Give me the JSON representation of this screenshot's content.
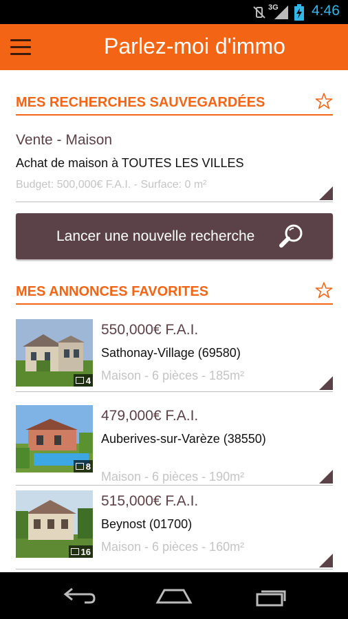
{
  "status_bar": {
    "network": "3G",
    "time": "4:46",
    "time_color": "#33b5e5"
  },
  "app_bar": {
    "title": "Parlez-moi d'immo",
    "color": "#f36515",
    "menu_icon": "hamburger-menu-icon"
  },
  "saved_searches": {
    "heading": "MES RECHERCHES SAUVEGARDÉES",
    "star_icon": "star-outline-icon",
    "items": [
      {
        "type": "Vente - Maison",
        "description": "Achat de maison à TOUTES LES VILLES",
        "meta": "Budget: 500,000€ F.A.I. - Surface: 0 m²"
      }
    ]
  },
  "new_search_button": {
    "label": "Lancer une nouvelle recherche",
    "icon": "search-magnifier-icon",
    "color": "#5b4248"
  },
  "favorites": {
    "heading": "MES ANNONCES FAVORITES",
    "star_icon": "star-outline-icon",
    "items": [
      {
        "price": "550,000€ F.A.I.",
        "city": "Sathonay-Village (69580)",
        "details": "Maison - 6 pièces - 185m²",
        "photo_count": "4"
      },
      {
        "price": "479,000€ F.A.I.",
        "city": "Auberives-sur-Varèze (38550)",
        "details": "Maison - 6 pièces - 190m²",
        "photo_count": "8"
      },
      {
        "price": "515,000€ F.A.I.",
        "city": "Beynost (01700)",
        "details": "Maison - 6 pièces - 160m²",
        "photo_count": "16"
      }
    ]
  },
  "nav_bar": {
    "back_icon": "back-arrow-icon",
    "home_icon": "home-icon",
    "recents_icon": "recent-apps-icon"
  }
}
